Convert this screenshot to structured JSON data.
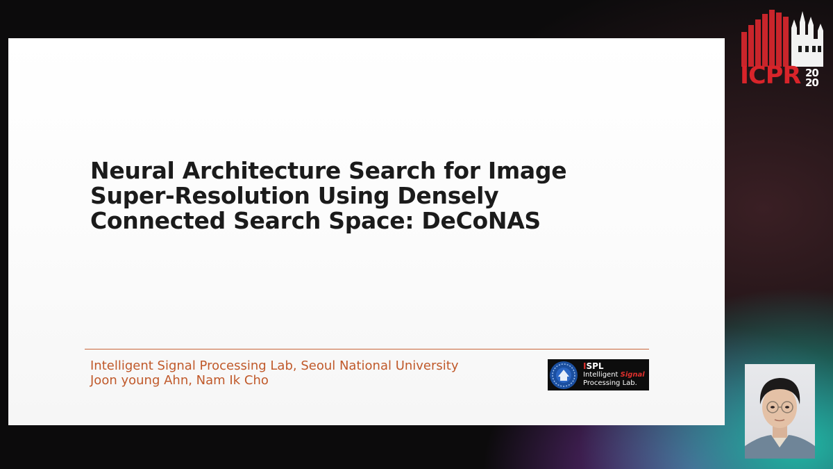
{
  "slide": {
    "title_lines": [
      "Neural Architecture Search for Image",
      "Super-Resolution Using Densely",
      "Connected Search Space: DeCoNAS"
    ],
    "affiliation": "Intelligent Signal Processing Lab, Seoul National University",
    "authors": "Joon young Ahn, Nam Ik Cho"
  },
  "lab_logo": {
    "abbr_prefix": "I",
    "abbr_rest": "SPL",
    "line1_a": "Intelligent ",
    "line1_b": "Signal",
    "line2": "Processing Lab."
  },
  "conference_logo": {
    "name": "ICPR",
    "year_top": "20",
    "year_bottom": "20"
  },
  "colors": {
    "title": "#1b1b1b",
    "affiliation": "#c0592a",
    "divider": "#c8663a",
    "icpr_red": "#d8242a",
    "ispl_red": "#e0302d"
  }
}
